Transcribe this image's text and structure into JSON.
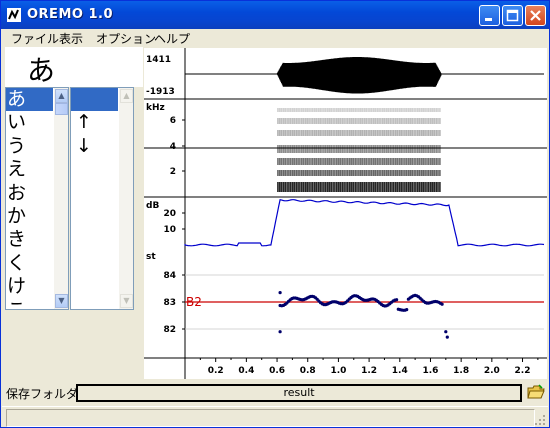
{
  "window": {
    "title": "OREMO 1.0"
  },
  "menu": [
    "ファイル",
    "表示",
    "オプション",
    "ヘルプ"
  ],
  "current_char": "あ",
  "char_list": [
    "あ",
    "い",
    "う",
    "え",
    "お",
    "か",
    "き",
    "く",
    "け",
    "こ"
  ],
  "char_list_selected": 0,
  "suffix_list": [
    "",
    "↑",
    "↓"
  ],
  "panels": {
    "wave": {
      "max": "1411",
      "min": "-1913"
    },
    "spectrogram": {
      "unit": "kHz",
      "ticks": [
        "6",
        "4",
        "2"
      ]
    },
    "power": {
      "unit": "dB",
      "ticks": [
        "20",
        "10"
      ]
    },
    "pitch": {
      "unit": "st",
      "ticks": [
        "84",
        "83",
        "82"
      ],
      "target_label": "B2",
      "target_value": 83
    }
  },
  "time_axis": {
    "ticks": [
      "0.2",
      "0.4",
      "0.6",
      "0.8",
      "1.0",
      "1.2",
      "1.4",
      "1.6",
      "1.8",
      "2.0",
      "2.2"
    ],
    "max": 2.34
  },
  "save_folder": {
    "label": "保存フォルダ:",
    "value": "result"
  },
  "colors": {
    "accent_blue": "#0000cc",
    "target_line": "#cc0000",
    "selection": "#316ac5"
  }
}
